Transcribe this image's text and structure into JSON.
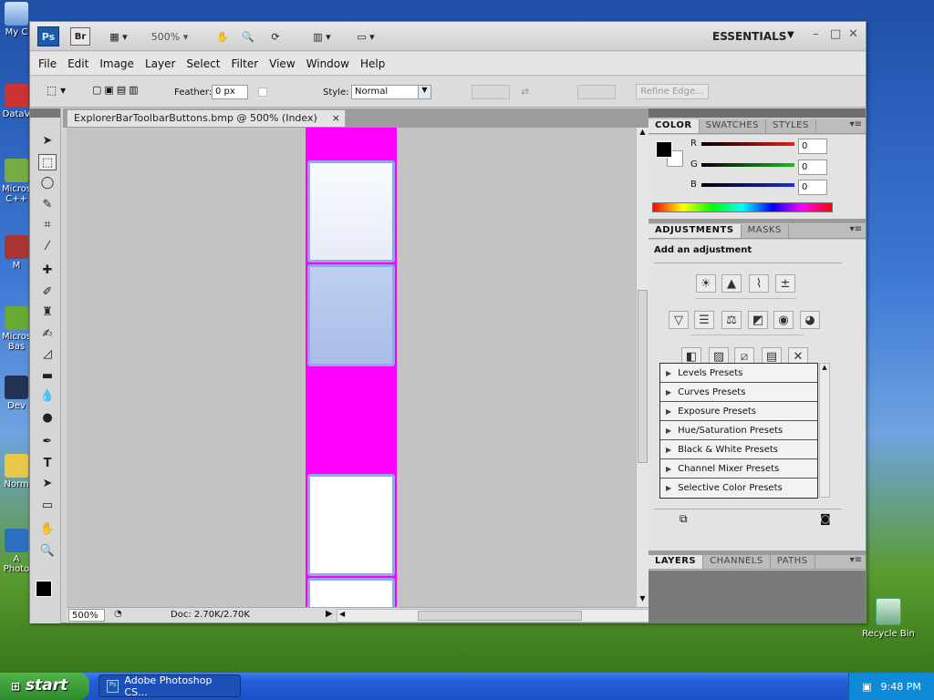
{
  "desktop": {
    "icons": [
      "My C",
      "DataV",
      "Micros C++",
      "M",
      "Micros Bas",
      "Dev",
      "Norm",
      "A Photo"
    ],
    "recycle_bin": "Recycle Bin"
  },
  "appbar": {
    "ps_logo": "Ps",
    "br_logo": "Br",
    "zoom": "500%",
    "workspace": "ESSENTIALS"
  },
  "menu": [
    "File",
    "Edit",
    "Image",
    "Layer",
    "Select",
    "Filter",
    "View",
    "Window",
    "Help"
  ],
  "options": {
    "feather_label": "Feather:",
    "feather_value": "0 px",
    "style_label": "Style:",
    "style_value": "Normal",
    "refine_edge": "Refine Edge..."
  },
  "document": {
    "tab_title": "ExplorerBarToolbarButtons.bmp @ 500% (Index)",
    "close": "×"
  },
  "status": {
    "zoom": "500%",
    "doc_info": "Doc: 2.70K/2.70K"
  },
  "color_panel": {
    "tabs": [
      "COLOR",
      "SWATCHES",
      "STYLES"
    ],
    "channels": [
      {
        "label": "R",
        "value": "0",
        "color": "#e0201f"
      },
      {
        "label": "G",
        "value": "0",
        "color": "#1fb81f"
      },
      {
        "label": "B",
        "value": "0",
        "color": "#1f2bd8"
      }
    ]
  },
  "adjustments_panel": {
    "tabs": [
      "ADJUSTMENTS",
      "MASKS"
    ],
    "title": "Add an adjustment",
    "presets": [
      "Levels Presets",
      "Curves Presets",
      "Exposure Presets",
      "Hue/Saturation Presets",
      "Black & White Presets",
      "Channel Mixer Presets",
      "Selective Color Presets"
    ]
  },
  "layers_panel": {
    "tabs": [
      "LAYERS",
      "CHANNELS",
      "PATHS"
    ]
  },
  "taskbar": {
    "start": "start",
    "task": "Adobe Photoshop CS...",
    "clock": "9:48 PM"
  },
  "colors": {
    "magenta": "#ff00ff",
    "button_border": "#8fa9e6",
    "selected_button": "#a9bde8"
  }
}
